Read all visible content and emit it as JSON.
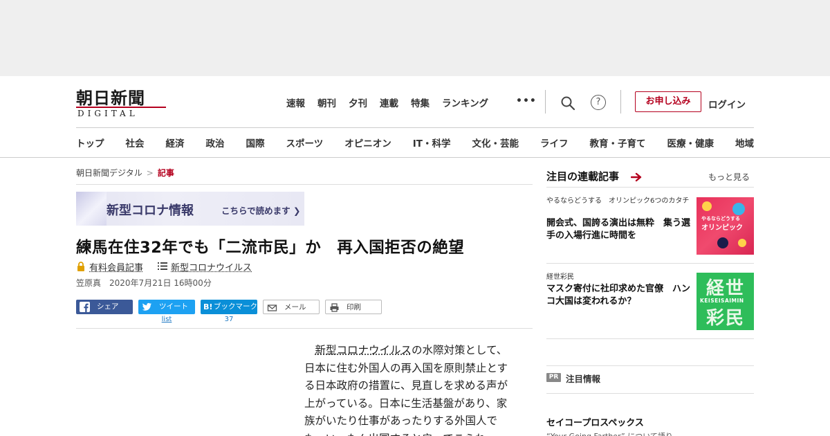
{
  "header": {
    "logo": {
      "main": "朝日新聞",
      "sub": "DIGITAL"
    },
    "topnav": [
      "速報",
      "朝刊",
      "夕刊",
      "連載",
      "特集",
      "ランキング"
    ],
    "more_label": "•••",
    "help_label": "?",
    "subscribe_label": "お申し込み",
    "login_label": "ログイン",
    "accent_color": "#b4001e"
  },
  "category_nav": [
    "トップ",
    "社会",
    "経済",
    "政治",
    "国際",
    "スポーツ",
    "オピニオン",
    "IT・科学",
    "文化・芸能",
    "ライフ",
    "教育・子育て",
    "医療・健康",
    "地域"
  ],
  "breadcrumb": {
    "root": "朝日新聞デジタル",
    "separator": ">",
    "current": "記事"
  },
  "corona_banner": {
    "title": "新型コロナ情報",
    "link": "こちらで読めます"
  },
  "article": {
    "headline": "練馬在住32年でも「二流市民」か　再入国拒否の絶望",
    "member_label": "有料会員記事",
    "topic": "新型コロナウイルス",
    "author": "笠原真",
    "date": "2020年7月21日 16時00分",
    "body_keyword": "新型コロナウイルス",
    "body_rest": "の水際対策として、日本に住む外国人の再入国を原則禁止とする日本政府の措置に、見直しを求める声が上がっている。日本に生活基盤があり、家族がいたり仕事があったりする外国人でも、いったん出国すると戻ってこられ"
  },
  "share": {
    "facebook": "シェア",
    "twitter": "ツイート",
    "hatena_icon": "B!",
    "hatena": "ブックマーク",
    "mail": "メール",
    "print": "印刷",
    "twitter_count": "list",
    "hatena_count": "37"
  },
  "sidebar": {
    "title": "注目の連載記事",
    "more": "もっと見る",
    "items": [
      {
        "series": "やるならどうする　オリンピック6つのカタチ",
        "title": "開会式、国誇る演出は無粋　集う選手の入場行進に時間を",
        "thumb_line1": "やるならどうする",
        "thumb_line2": "オリンピック"
      },
      {
        "series": "経世彩民",
        "title": "マスク寄付に社印求めた官僚　ハンコ大国は変われるか？",
        "thumb_top": "経世",
        "thumb_mid": "KEISEISAIMIN",
        "thumb_bottom": "彩民"
      }
    ],
    "pr": {
      "badge": "PR",
      "title": "注目情報",
      "sponsor": "セイコープロスペックス",
      "snippet": "“Your Going Farther” について語り"
    }
  }
}
